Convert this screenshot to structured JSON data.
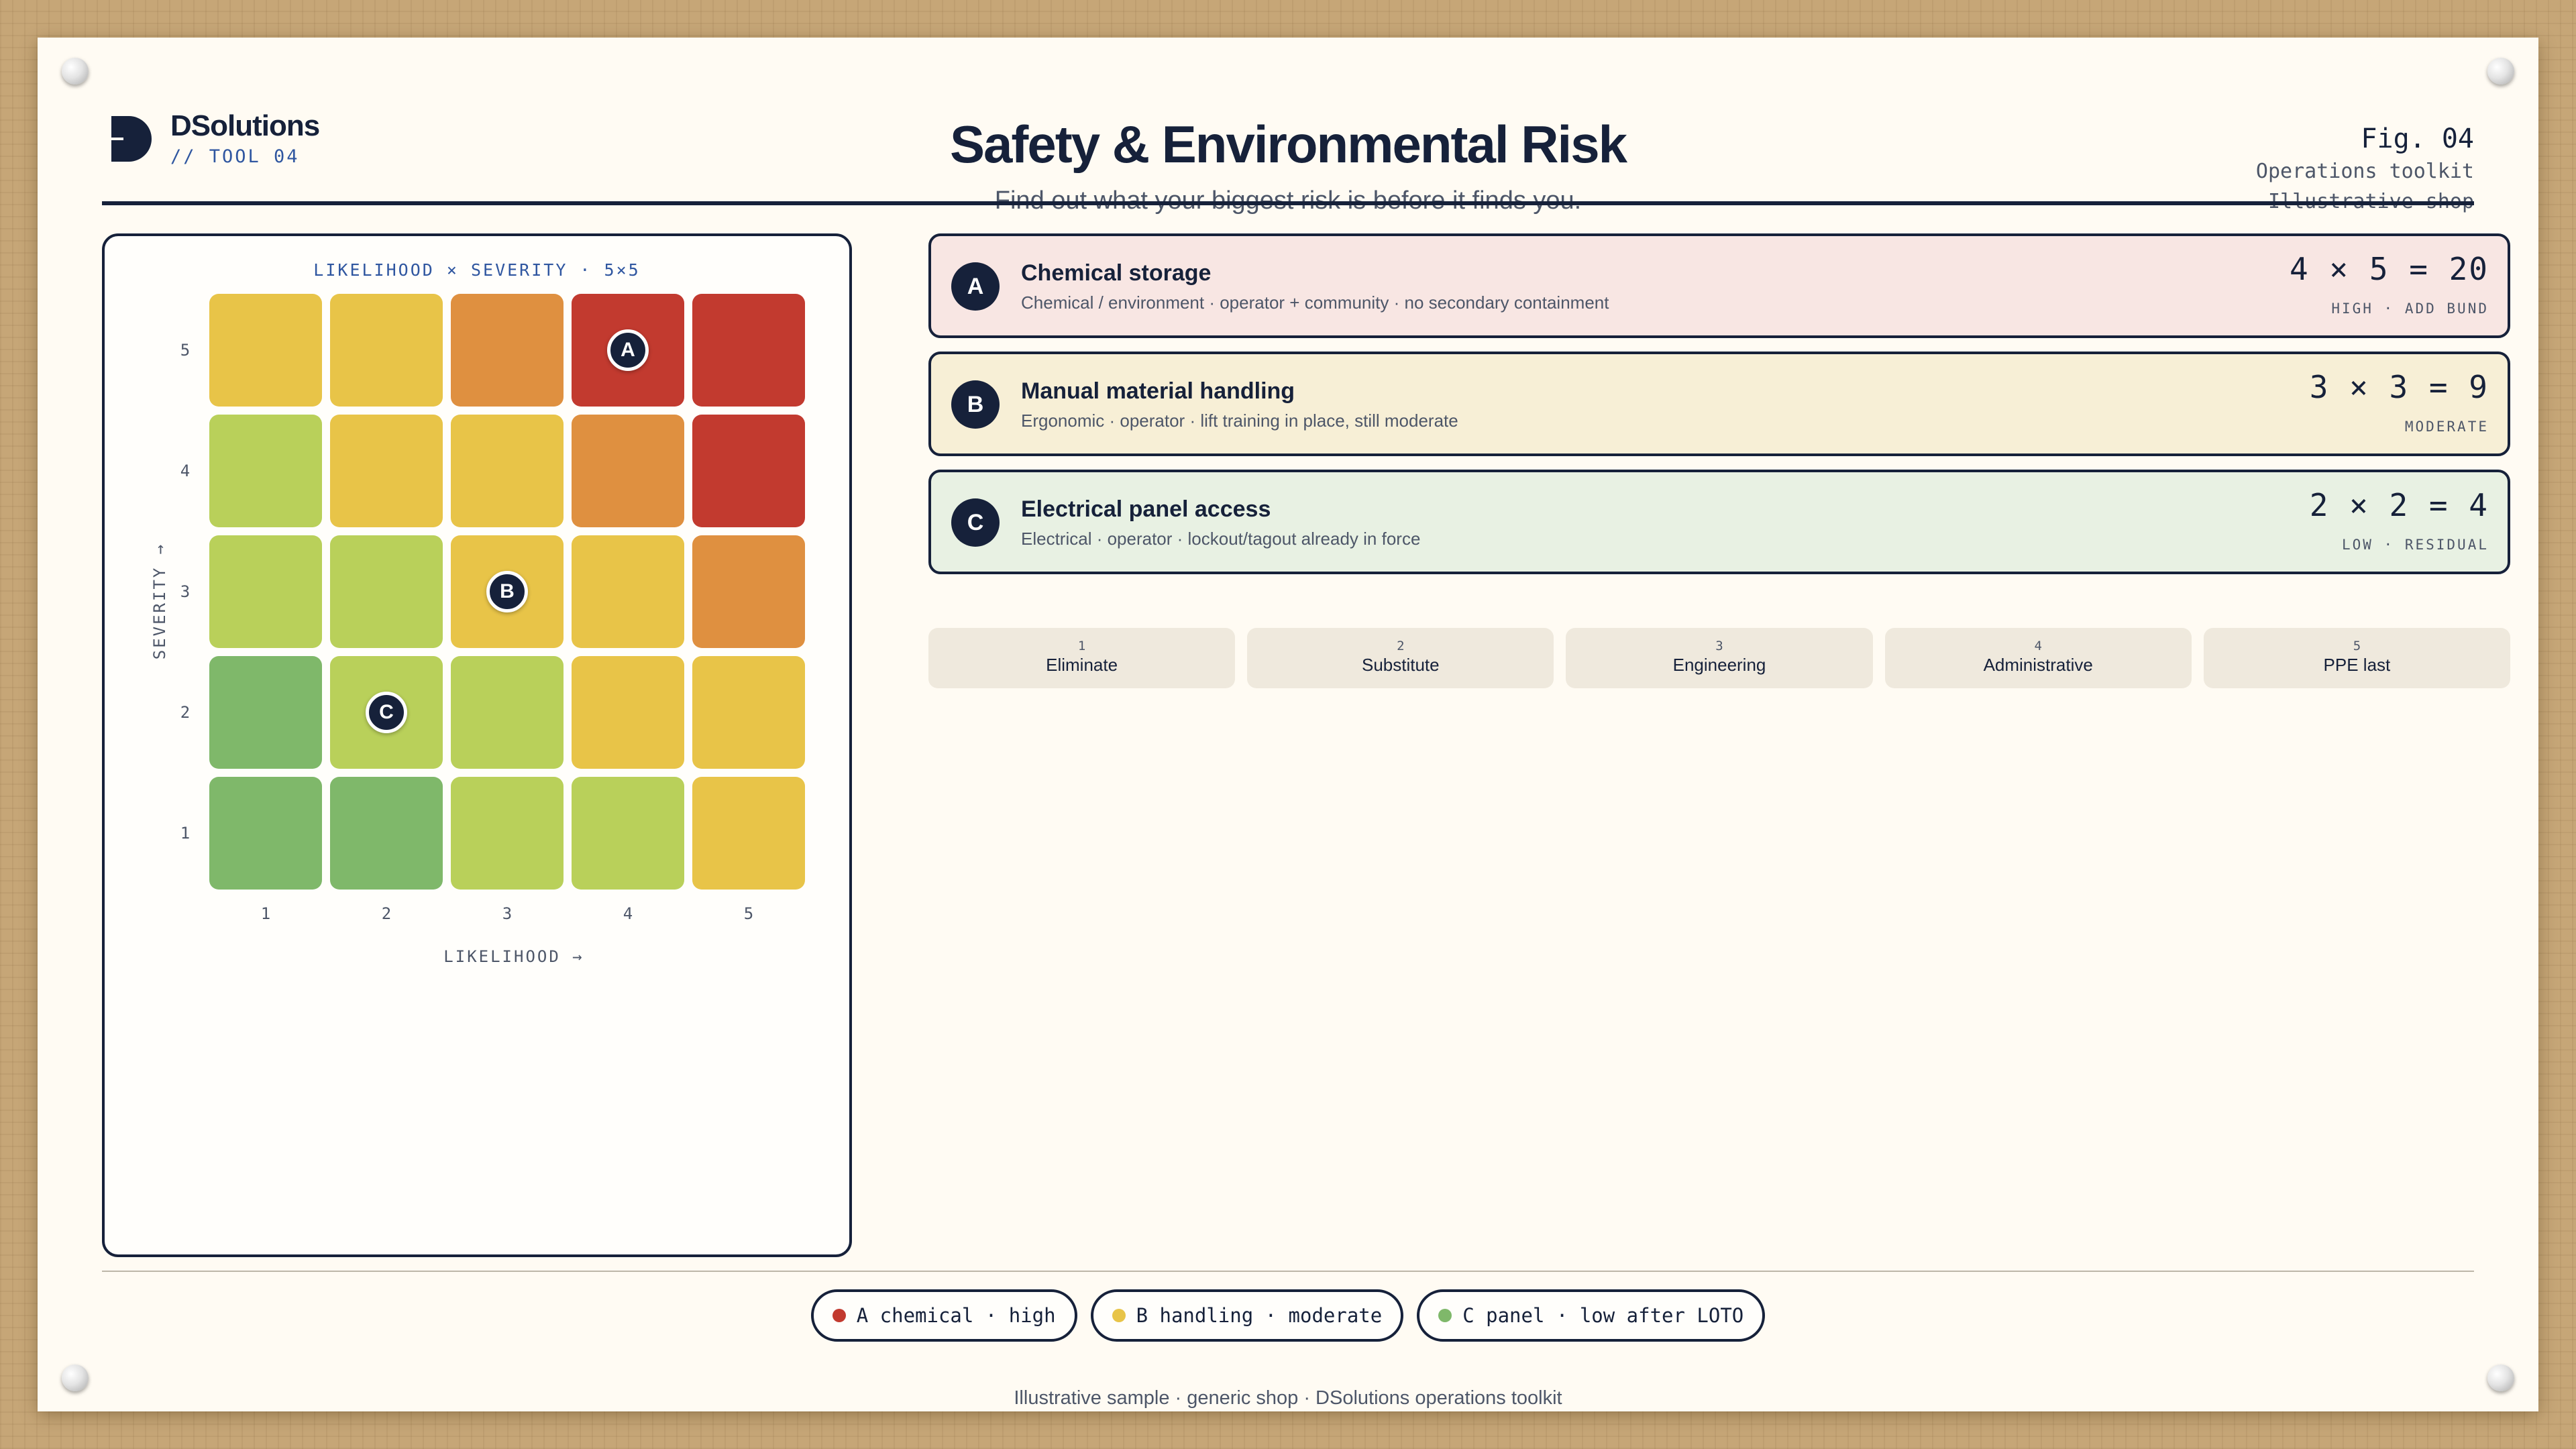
{
  "brand": {
    "name": "DSolutions",
    "tool": "// TOOL 04"
  },
  "header": {
    "title": "Safety & Environmental Risk",
    "subtitle": "Find out what your biggest risk is before it finds you.",
    "fig": "Fig. 04",
    "fig_line1": "Operations toolkit",
    "fig_line2": "Illustrative shop"
  },
  "matrix": {
    "title": "LIKELIHOOD × SEVERITY · 5×5",
    "x_label": "LIKELIHOOD →",
    "y_label": "SEVERITY →",
    "col_labels": [
      "1",
      "2",
      "3",
      "4",
      "5"
    ],
    "row_labels": [
      "5",
      "4",
      "3",
      "2",
      "1"
    ],
    "colors": {
      "green": "#7fb86a",
      "lime": "#b9d05a",
      "yellow": "#e8c448",
      "orange": "#df9040",
      "red": "#c23a2f"
    },
    "grid": [
      [
        "yellow",
        "yellow",
        "orange",
        "red",
        "red"
      ],
      [
        "lime",
        "yellow",
        "yellow",
        "orange",
        "red"
      ],
      [
        "lime",
        "lime",
        "yellow",
        "yellow",
        "orange"
      ],
      [
        "green",
        "lime",
        "lime",
        "yellow",
        "yellow"
      ],
      [
        "green",
        "green",
        "lime",
        "lime",
        "yellow"
      ]
    ],
    "markers": [
      {
        "label": "A",
        "likelihood": 4,
        "severity": 5
      },
      {
        "label": "B",
        "likelihood": 3,
        "severity": 3
      },
      {
        "label": "C",
        "likelihood": 2,
        "severity": 2
      }
    ]
  },
  "risks": [
    {
      "badge": "A",
      "title": "Chemical storage",
      "desc": "Chemical / environment · operator + community · no secondary containment",
      "score": "4 × 5 = 20",
      "tag": "HIGH · ADD BUND",
      "bg": "#f8e6e3"
    },
    {
      "badge": "B",
      "title": "Manual material handling",
      "desc": "Ergonomic · operator · lift training in place, still moderate",
      "score": "3 × 3 = 9",
      "tag": "MODERATE",
      "bg": "#f7efd6"
    },
    {
      "badge": "C",
      "title": "Electrical panel access",
      "desc": "Electrical · operator · lockout/tagout already in force",
      "score": "2 × 2 = 4",
      "tag": "LOW · RESIDUAL",
      "bg": "#e8f1e3"
    }
  ],
  "controls": [
    {
      "num": "1",
      "label": "Eliminate"
    },
    {
      "num": "2",
      "label": "Substitute"
    },
    {
      "num": "3",
      "label": "Engineering"
    },
    {
      "num": "4",
      "label": "Administrative"
    },
    {
      "num": "5",
      "label": "PPE last"
    }
  ],
  "legend": [
    {
      "text": "A chemical · high",
      "color": "#c23a2f"
    },
    {
      "text": "B handling · moderate",
      "color": "#e8c448"
    },
    {
      "text": "C panel · low after LOTO",
      "color": "#7fb86a"
    }
  ],
  "footnote": "Illustrative sample · generic shop · DSolutions operations toolkit"
}
